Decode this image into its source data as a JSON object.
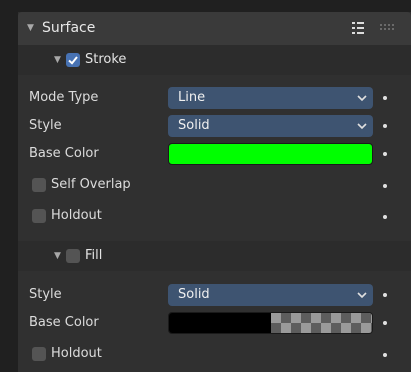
{
  "panel": {
    "title": "Surface",
    "expanded": true,
    "header_icons": [
      "list-icon",
      "drag-handle-icon"
    ]
  },
  "stroke": {
    "label": "Stroke",
    "enabled": true,
    "mode_type": {
      "label": "Mode Type",
      "value": "Line"
    },
    "style": {
      "label": "Style",
      "value": "Solid"
    },
    "base_color": {
      "label": "Base Color",
      "color": "#00ff00"
    },
    "self_overlap": {
      "label": "Self Overlap",
      "checked": false
    },
    "holdout": {
      "label": "Holdout",
      "checked": false
    }
  },
  "fill": {
    "label": "Fill",
    "enabled": false,
    "style": {
      "label": "Style",
      "value": "Solid"
    },
    "base_color": {
      "label": "Base Color",
      "color": "#000000",
      "alpha": "transparent-checker"
    },
    "holdout": {
      "label": "Holdout",
      "checked": false
    }
  },
  "colors": {
    "panel_bg": "#303030",
    "header_bg": "#3a3a3a",
    "dropdown_bg": "#3e5471",
    "checkbox_on": "#4772b3",
    "checkbox_off": "#545454"
  }
}
